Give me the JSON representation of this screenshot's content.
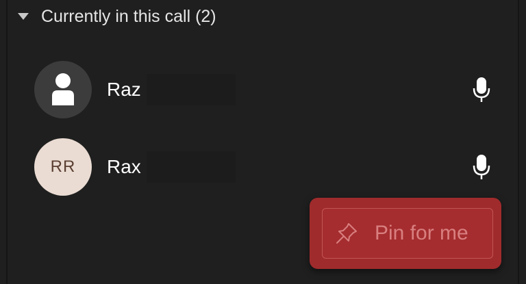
{
  "section": {
    "title": "Currently in this call (2)"
  },
  "participants": [
    {
      "name": "Raz",
      "avatar": "person-icon",
      "initials": ""
    },
    {
      "name": "Rax",
      "avatar": "initials",
      "initials": "RR"
    }
  ],
  "pin_menu": {
    "label": "Pin for me",
    "icon": "pin-icon"
  },
  "colors": {
    "background": "#1f1f1f",
    "popup": "#a02b2c",
    "pin_text": "#d97f80",
    "initials_avatar": "#eadcd3"
  }
}
